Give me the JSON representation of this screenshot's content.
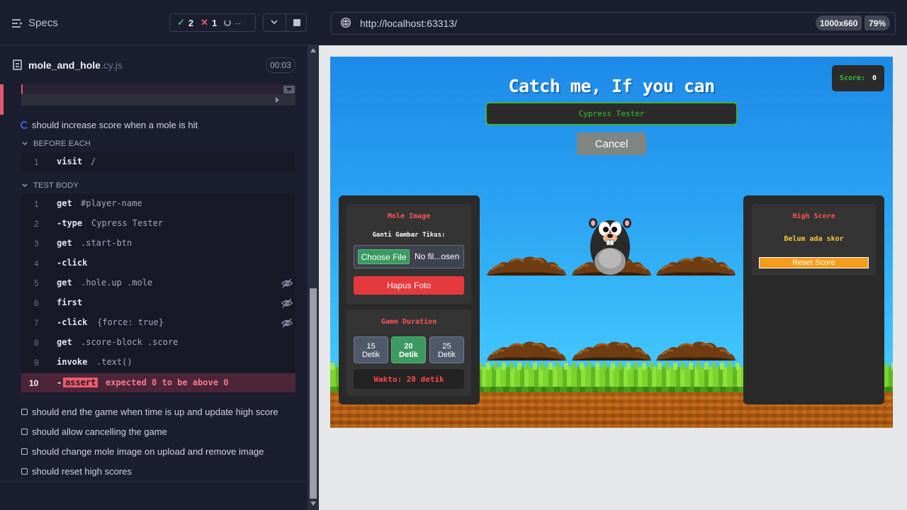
{
  "runner": {
    "specs_label": "Specs",
    "stats": {
      "passed": "2",
      "failed": "1",
      "pending": "--"
    },
    "spec_file": {
      "name": "mole_and_hole",
      "ext": ".cy.js",
      "duration": "00:03"
    },
    "current_test": "should increase score when a mole is hit",
    "before_each": {
      "label": "BEFORE EACH",
      "commands": [
        {
          "num": "1",
          "name": "visit",
          "arg": "/"
        }
      ]
    },
    "test_body": {
      "label": "TEST BODY",
      "commands": [
        {
          "num": "1",
          "name": "get",
          "arg": "#player-name"
        },
        {
          "num": "2",
          "name": "-type",
          "arg": "Cypress Tester"
        },
        {
          "num": "3",
          "name": "get",
          "arg": ".start-btn"
        },
        {
          "num": "4",
          "name": "-click",
          "arg": ""
        },
        {
          "num": "5",
          "name": "get",
          "arg": ".hole.up .mole"
        },
        {
          "num": "6",
          "name": "first",
          "arg": ""
        },
        {
          "num": "7",
          "name": "-click",
          "arg": "{force: true}"
        },
        {
          "num": "8",
          "name": "get",
          "arg": ".score-block .score"
        },
        {
          "num": "9",
          "name": "invoke",
          "arg": ".text()"
        }
      ],
      "failed": {
        "num": "10",
        "dash": "-",
        "chip": "assert",
        "msg_expected": "expected",
        "val_a": "0",
        "msg_mid": "to be above",
        "val_b": "0"
      }
    },
    "other_tests": [
      "should end the game when time is up and update high score",
      "should allow cancelling the game",
      "should change mole image on upload and remove image",
      "should reset high scores"
    ]
  },
  "browser": {
    "url": "http://localhost:63313/",
    "viewport": "1000x660",
    "zoom": "79%"
  },
  "game": {
    "title": "Catch me, If you can",
    "player_name": "Cypress Tester",
    "cancel_label": "Cancel",
    "score_label": "Score:",
    "score_value": "0",
    "mole_image": {
      "title": "Mole Image",
      "subtitle": "Ganti Gambar Tikus:",
      "choose_file": "Choose File",
      "file_status": "No fil...osen",
      "remove_label": "Hapus Foto"
    },
    "duration": {
      "title": "Game Duration",
      "options": [
        {
          "value": "15",
          "unit": "Detik"
        },
        {
          "value": "20",
          "unit": "Detik"
        },
        {
          "value": "25",
          "unit": "Detik"
        }
      ],
      "selected": "20",
      "timer_text": "Waktu: 20 detik"
    },
    "high_score": {
      "title": "High Score",
      "empty_text": "Belum ada skor",
      "reset_label": "Reset Score"
    }
  },
  "colors": {
    "runner_bg": "#1b1e2e",
    "fail_accent": "#e45770",
    "pass": "#3fb77c",
    "sky": "#2aa2f2",
    "grass": "#6fc926",
    "dirt": "#b35a13",
    "panel": "#2a2a2a",
    "accent_red": "#ff5454",
    "accent_green": "#35c035"
  }
}
